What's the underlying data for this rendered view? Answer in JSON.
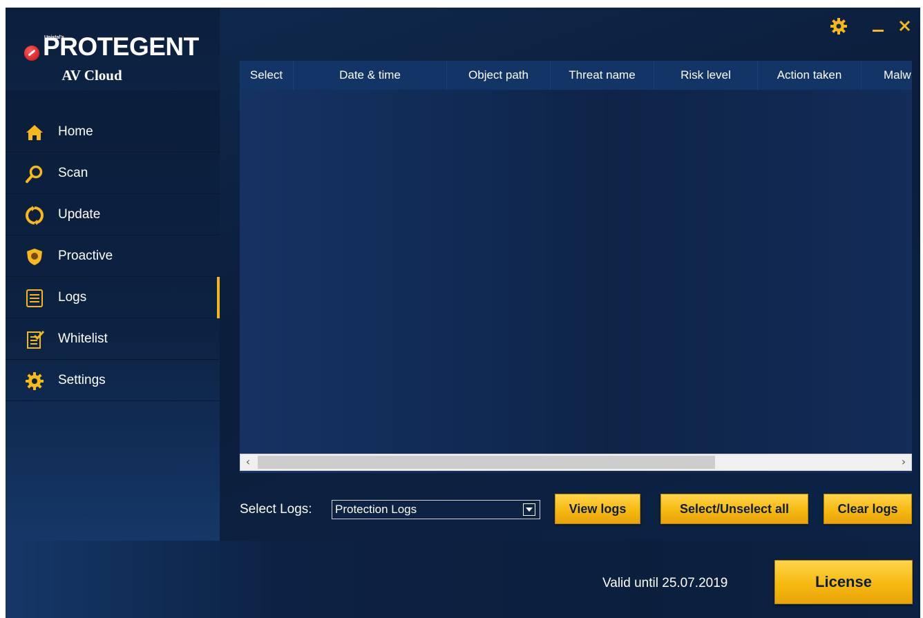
{
  "app": {
    "brand_small": "Unistal's",
    "brand_name": "PROTEGENT",
    "product": "AV Cloud"
  },
  "sidebar": {
    "items": [
      {
        "label": "Home",
        "icon": "home-icon"
      },
      {
        "label": "Scan",
        "icon": "magnifier-icon"
      },
      {
        "label": "Update",
        "icon": "refresh-icon"
      },
      {
        "label": "Proactive",
        "icon": "shield-icon"
      },
      {
        "label": "Logs",
        "icon": "list-icon",
        "active": true
      },
      {
        "label": "Whitelist",
        "icon": "checklist-icon"
      },
      {
        "label": "Settings",
        "icon": "gear-icon"
      }
    ]
  },
  "window_controls": {
    "settings_icon": "gear-icon",
    "minimize_icon": "minimize-icon",
    "close_icon": "close-icon"
  },
  "table": {
    "columns": [
      "Select",
      "Date & time",
      "Object path",
      "Threat name",
      "Risk level",
      "Action taken",
      "Malw"
    ],
    "rows": []
  },
  "logs": {
    "select_label": "Select Logs:",
    "selected_log": "Protection Logs",
    "view_button": "View logs",
    "select_all_button": "Select/Unselect all",
    "clear_button": "Clear logs"
  },
  "footer": {
    "valid_text": "Valid until 25.07.2019",
    "license_button": "License"
  },
  "colors": {
    "accent": "#f2b51a",
    "background": "#0b1e3b",
    "header": "#123466"
  }
}
